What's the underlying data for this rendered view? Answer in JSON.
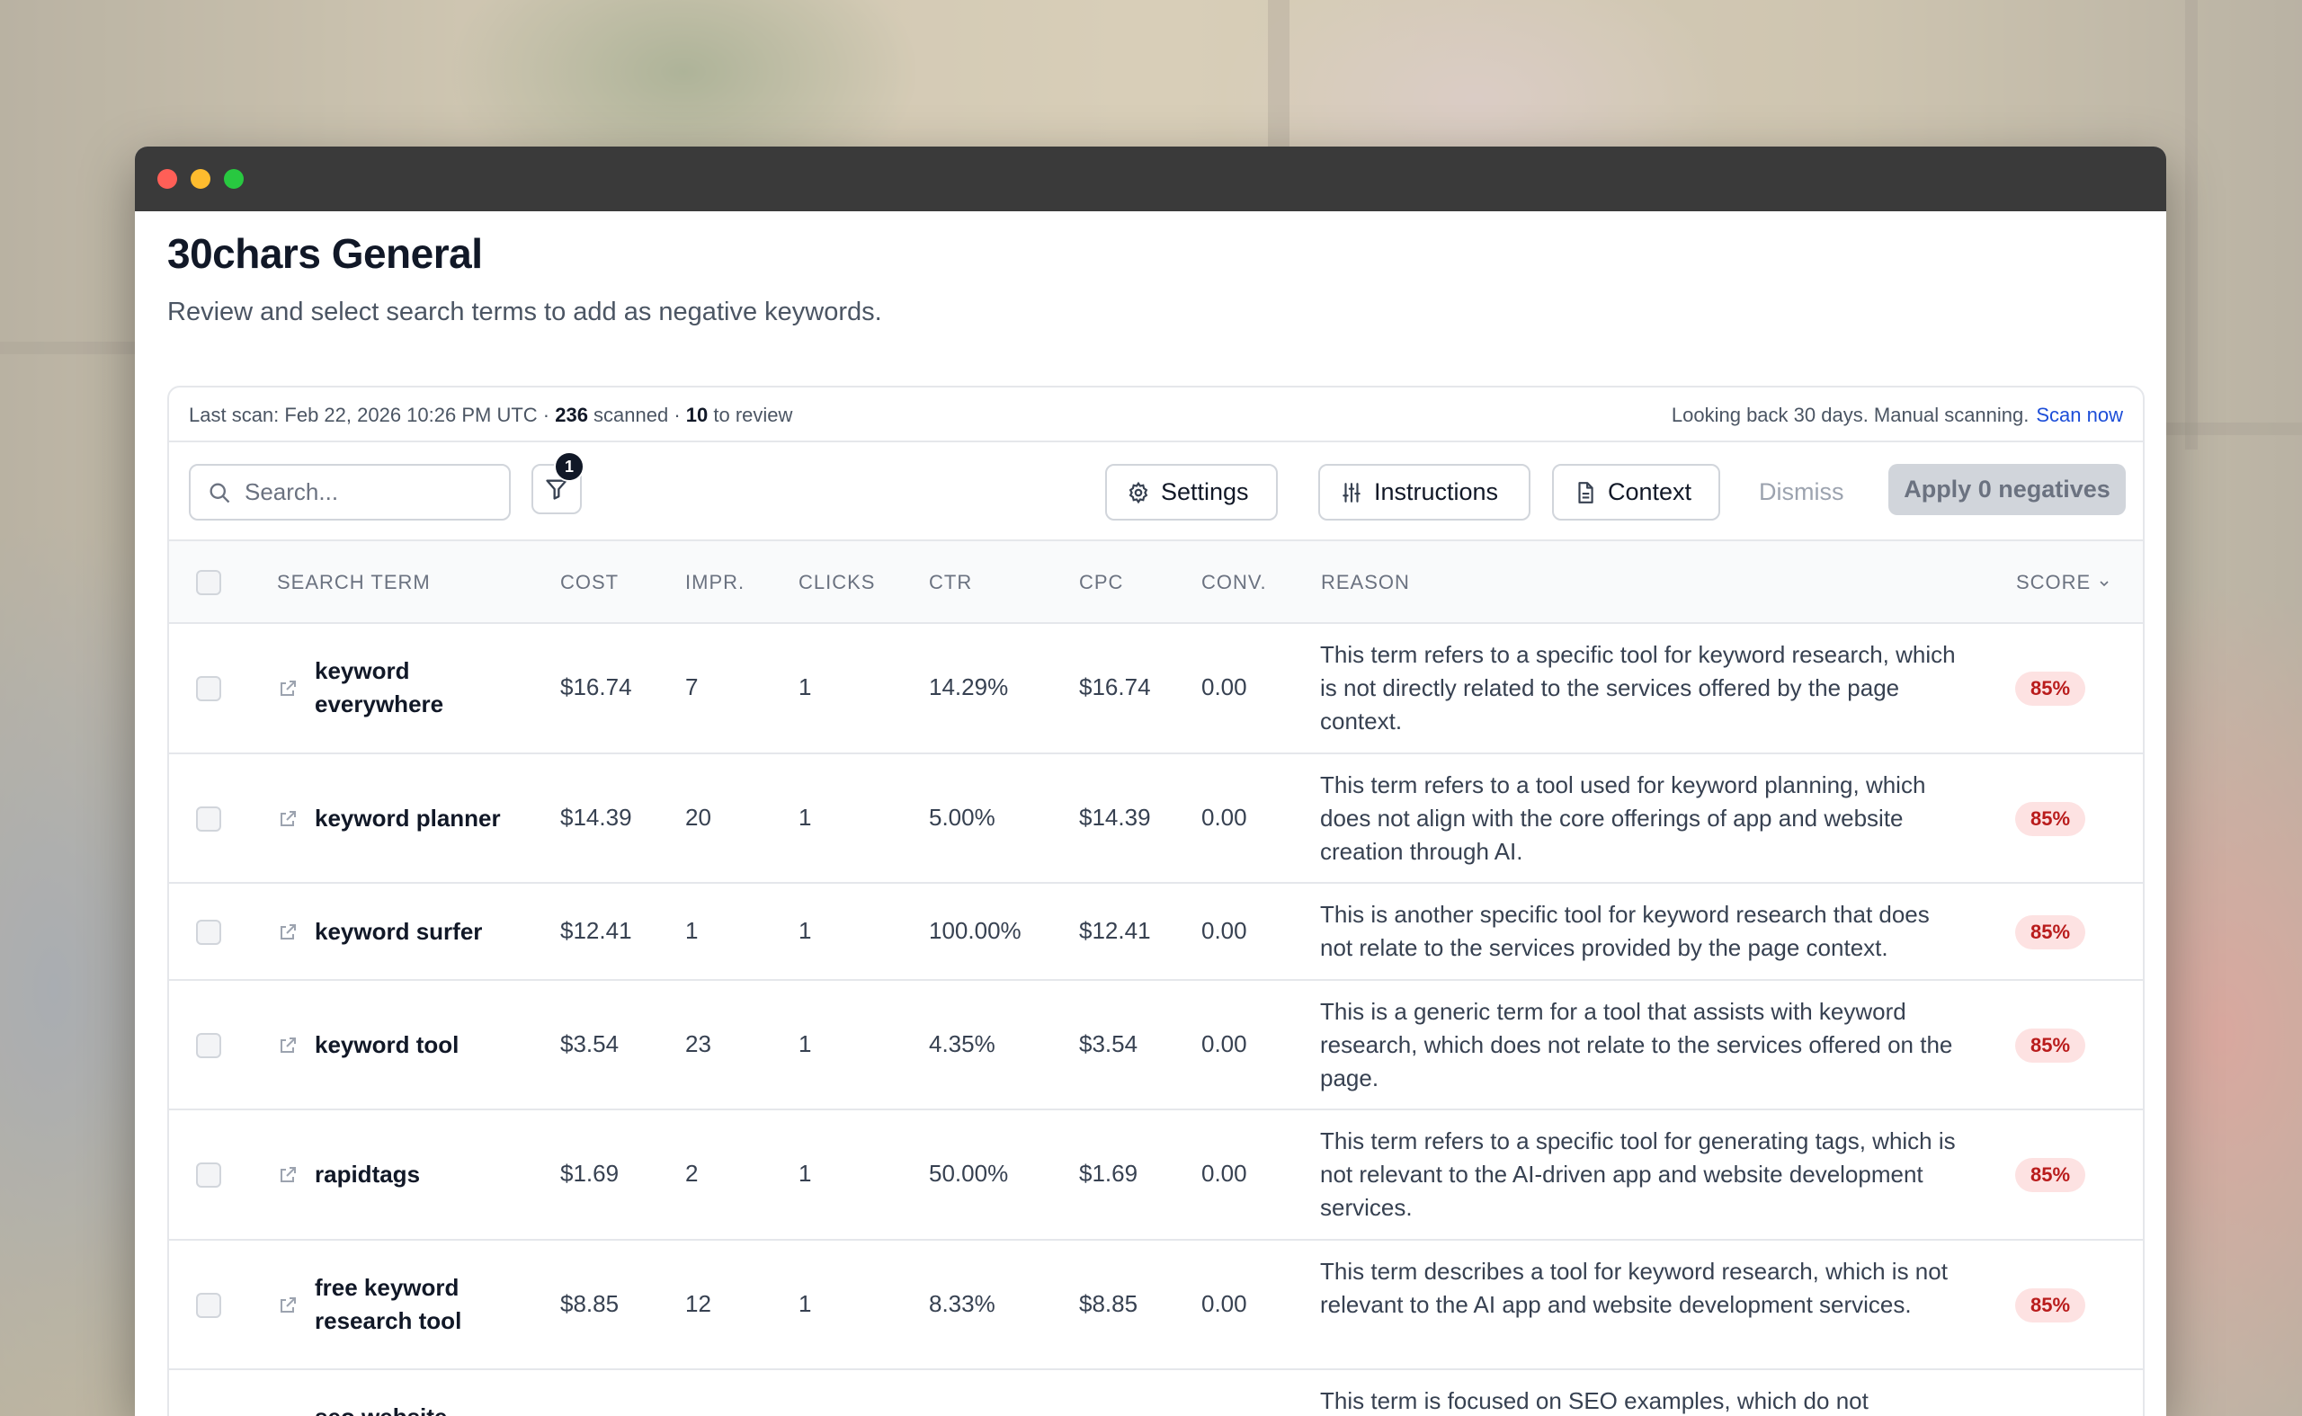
{
  "app": {
    "title": "30chars General",
    "subtitle": "Review and select search terms to add as negative keywords."
  },
  "scan": {
    "last_scan_label": "Last scan: Feb 22, 2026 10:26 PM UTC · ",
    "scanned_count": "236",
    "scanned_label": " scanned · ",
    "review_count": "10",
    "review_label": " to review",
    "lookback": "Looking back 30 days. Manual scanning.",
    "scan_now": "Scan now"
  },
  "toolbar": {
    "search_placeholder": "Search...",
    "filter_badge": "1",
    "settings_label": "Settings",
    "instructions_label": "Instructions",
    "context_label": "Context",
    "dismiss_label": "Dismiss",
    "apply_label": "Apply 0 negatives"
  },
  "table": {
    "headers": {
      "term": "SEARCH TERM",
      "cost": "COST",
      "impr": "IMPR.",
      "clicks": "CLICKS",
      "ctr": "CTR",
      "cpc": "CPC",
      "conv": "CONV.",
      "reason": "REASON",
      "score": "SCORE"
    },
    "rows": [
      {
        "term": "keyword everywhere",
        "cost": "$16.74",
        "impr": "7",
        "clicks": "1",
        "ctr": "14.29%",
        "cpc": "$16.74",
        "conv": "0.00",
        "reason": "This term refers to a specific tool for keyword research, which is not directly related to the services offered by the page context.",
        "score": "85%"
      },
      {
        "term": "keyword planner",
        "cost": "$14.39",
        "impr": "20",
        "clicks": "1",
        "ctr": "5.00%",
        "cpc": "$14.39",
        "conv": "0.00",
        "reason": "This term refers to a tool used for keyword planning, which does not align with the core offerings of app and website creation through AI.",
        "score": "85%"
      },
      {
        "term": "keyword surfer",
        "cost": "$12.41",
        "impr": "1",
        "clicks": "1",
        "ctr": "100.00%",
        "cpc": "$12.41",
        "conv": "0.00",
        "reason": "This is another specific tool for keyword research that does not relate to the services provided by the page context.",
        "score": "85%"
      },
      {
        "term": "keyword tool",
        "cost": "$3.54",
        "impr": "23",
        "clicks": "1",
        "ctr": "4.35%",
        "cpc": "$3.54",
        "conv": "0.00",
        "reason": "This is a generic term for a tool that assists with keyword research, which does not relate to the services offered on the page.",
        "score": "85%"
      },
      {
        "term": "rapidtags",
        "cost": "$1.69",
        "impr": "2",
        "clicks": "1",
        "ctr": "50.00%",
        "cpc": "$1.69",
        "conv": "0.00",
        "reason": "This term refers to a specific tool for generating tags, which is not relevant to the AI-driven app and website development services.",
        "score": "85%"
      },
      {
        "term": "free keyword research tool",
        "cost": "$8.85",
        "impr": "12",
        "clicks": "1",
        "ctr": "8.33%",
        "cpc": "$8.85",
        "conv": "0.00",
        "reason": "This term describes a tool for keyword research, which is not relevant to the AI app and website development services.",
        "score": "85%"
      },
      {
        "term": "seo website",
        "cost": "",
        "impr": "",
        "clicks": "",
        "ctr": "",
        "cpc": "",
        "conv": "",
        "reason": "This term is focused on SEO examples, which do not",
        "score": ""
      }
    ]
  }
}
